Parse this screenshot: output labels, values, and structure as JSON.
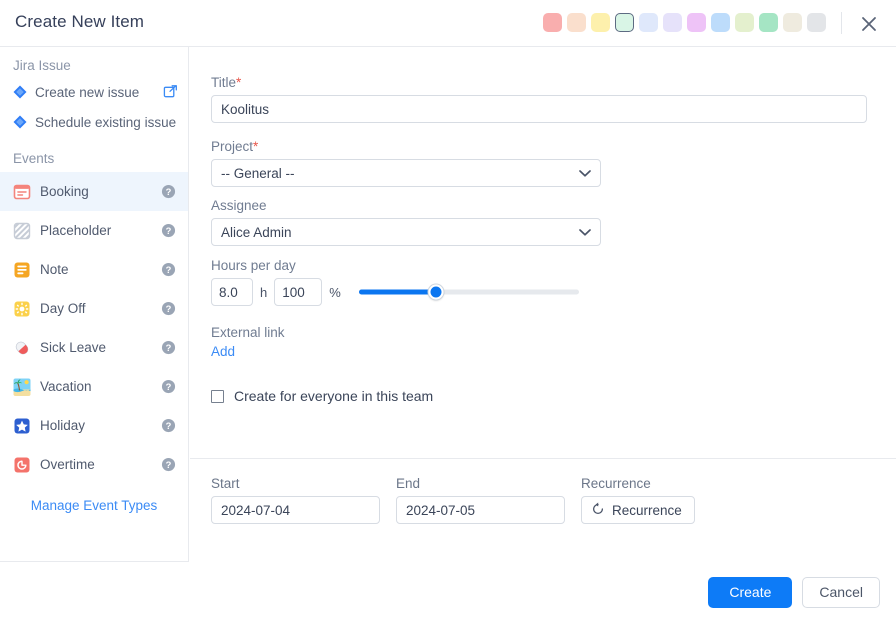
{
  "header": {
    "title": "Create New Item",
    "close_icon": "close-icon",
    "swatches": [
      {
        "name": "swatch-red",
        "color": "#f9aeae",
        "selected": false
      },
      {
        "name": "swatch-peach",
        "color": "#fadfcd",
        "selected": false
      },
      {
        "name": "swatch-yellow",
        "color": "#fdf0ac",
        "selected": false
      },
      {
        "name": "swatch-mint",
        "color": "#d9f5e6",
        "selected": true
      },
      {
        "name": "swatch-light-blue",
        "color": "#dfe8fb",
        "selected": false
      },
      {
        "name": "swatch-lavender",
        "color": "#e6e2fa",
        "selected": false
      },
      {
        "name": "swatch-violet",
        "color": "#eec3f7",
        "selected": false
      },
      {
        "name": "swatch-sky",
        "color": "#bddcfb",
        "selected": false
      },
      {
        "name": "swatch-lime",
        "color": "#e4f0ce",
        "selected": false
      },
      {
        "name": "swatch-green",
        "color": "#a5e5c4",
        "selected": false
      },
      {
        "name": "swatch-cream",
        "color": "#efebdf",
        "selected": false
      },
      {
        "name": "swatch-grey",
        "color": "#e3e5e8",
        "selected": false
      }
    ]
  },
  "sidebar": {
    "jira_section_title": "Jira Issue",
    "jira_items": [
      {
        "label": "Create new issue",
        "icon": "jira-diamond-icon",
        "has_external_link": true
      },
      {
        "label": "Schedule existing issue",
        "icon": "jira-diamond-icon",
        "has_external_link": false
      }
    ],
    "events_section_title": "Events",
    "events": [
      {
        "label": "Booking",
        "icon": "booking-icon",
        "active": true
      },
      {
        "label": "Placeholder",
        "icon": "placeholder-icon",
        "active": false
      },
      {
        "label": "Note",
        "icon": "note-icon",
        "active": false
      },
      {
        "label": "Day Off",
        "icon": "day-off-icon",
        "active": false
      },
      {
        "label": "Sick Leave",
        "icon": "sick-leave-icon",
        "active": false
      },
      {
        "label": "Vacation",
        "icon": "vacation-icon",
        "active": false
      },
      {
        "label": "Holiday",
        "icon": "holiday-icon",
        "active": false
      },
      {
        "label": "Overtime",
        "icon": "overtime-icon",
        "active": false
      }
    ],
    "manage_link": "Manage Event Types"
  },
  "form": {
    "title_label": "Title",
    "title_required": "*",
    "title_value": "Koolitus",
    "project_label": "Project",
    "project_required": "*",
    "project_value": "-- General --",
    "assignee_label": "Assignee",
    "assignee_value": "Alice Admin",
    "hours_label": "Hours per day",
    "hours_value": "8.0",
    "hours_unit": "h",
    "percent_value": "100",
    "percent_unit": "%",
    "slider_percent": 35,
    "external_link_label": "External link",
    "add_link": "Add",
    "team_checkbox_label": "Create for everyone in this team",
    "team_checkbox_checked": false,
    "start_label": "Start",
    "start_value": "2024-07-04",
    "end_label": "End",
    "end_value": "2024-07-05",
    "recurrence_label": "Recurrence",
    "recurrence_button": "Recurrence",
    "recurrence_icon": "refresh-icon"
  },
  "footer": {
    "create_label": "Create",
    "cancel_label": "Cancel"
  },
  "colors": {
    "accent": "#0d7bf7",
    "link": "#3b8bf5",
    "required": "#e8564a",
    "active_row": "#eef5fd"
  }
}
